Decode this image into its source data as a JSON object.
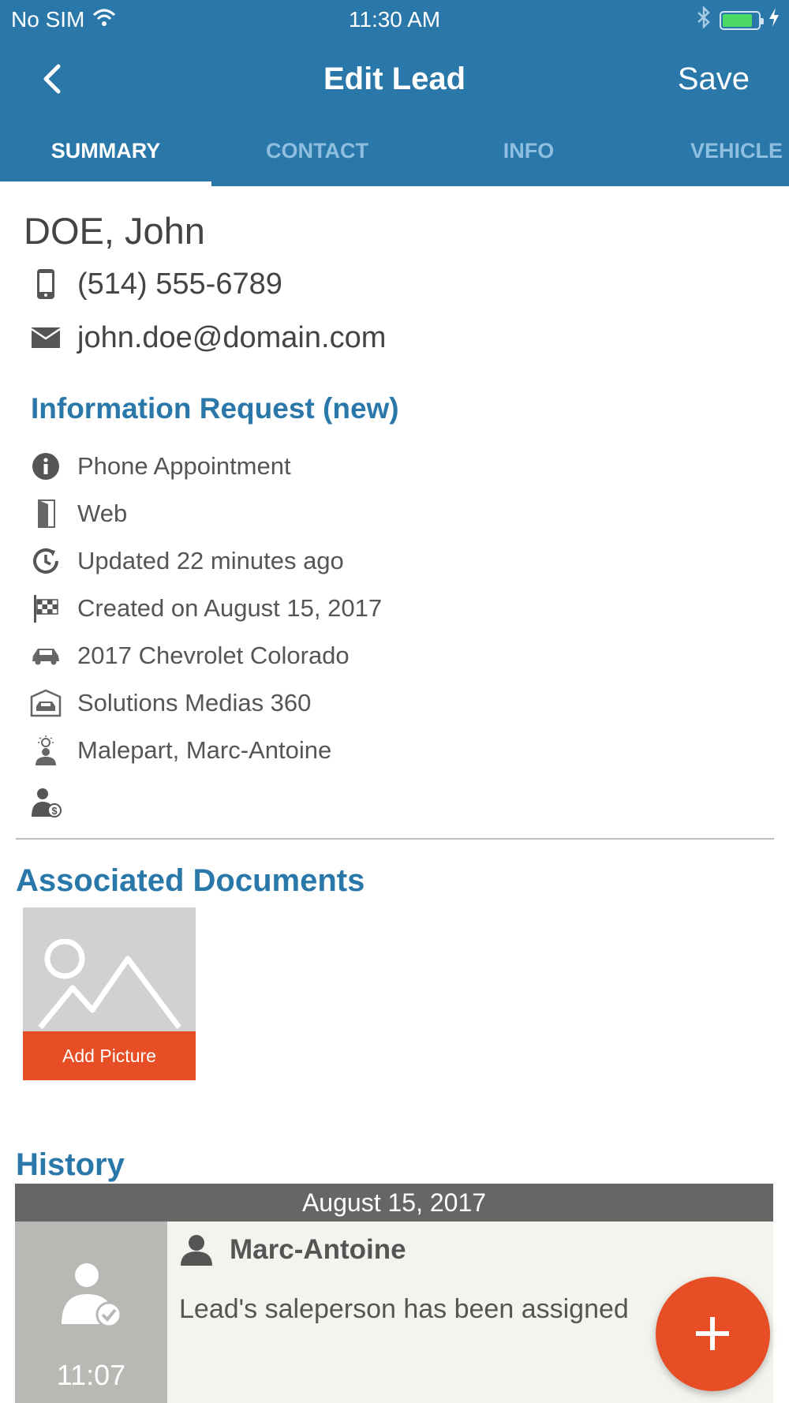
{
  "status_bar": {
    "carrier": "No SIM",
    "time": "11:30 AM",
    "battery_level": 0.85,
    "wifi_icon": "wifi-icon",
    "bluetooth_icon": "bluetooth-icon",
    "charging_icon": "charging-icon"
  },
  "nav": {
    "title": "Edit Lead",
    "back_icon": "chevron-left-icon",
    "save_label": "Save"
  },
  "tabs": [
    {
      "label": "SUMMARY",
      "active": true
    },
    {
      "label": "CONTACT",
      "active": false
    },
    {
      "label": "INFO",
      "active": false
    },
    {
      "label": "VEHICLE",
      "active": false
    }
  ],
  "lead": {
    "name": "DOE, John",
    "phone": "(514) 555-6789",
    "email": "john.doe@domain.com"
  },
  "request": {
    "title": "Information Request (new)",
    "items": [
      {
        "icon": "info-icon",
        "text": "Phone Appointment"
      },
      {
        "icon": "door-icon",
        "text": "Web"
      },
      {
        "icon": "clock-refresh-icon",
        "text": "Updated 22 minutes ago"
      },
      {
        "icon": "checkered-flag-icon",
        "text": "Created on August 15, 2017"
      },
      {
        "icon": "car-icon",
        "text": "2017 Chevrolet Colorado"
      },
      {
        "icon": "dealership-icon",
        "text": "Solutions Medias 360"
      },
      {
        "icon": "advisor-idea-icon",
        "text": "Malepart, Marc-Antoine"
      },
      {
        "icon": "salesperson-dollar-icon",
        "text": ""
      }
    ]
  },
  "documents": {
    "title": "Associated Documents",
    "add_picture_label": "Add Picture"
  },
  "history": {
    "title": "History",
    "date": "August 15, 2017",
    "entries": [
      {
        "time": "11:07",
        "user": "Marc-Antoine",
        "message": "Lead's saleperson has been assigned"
      }
    ]
  },
  "colors": {
    "brand_blue": "#2a77a9",
    "accent_orange": "#e84e26",
    "tab_inactive": "#8fbfe0"
  }
}
